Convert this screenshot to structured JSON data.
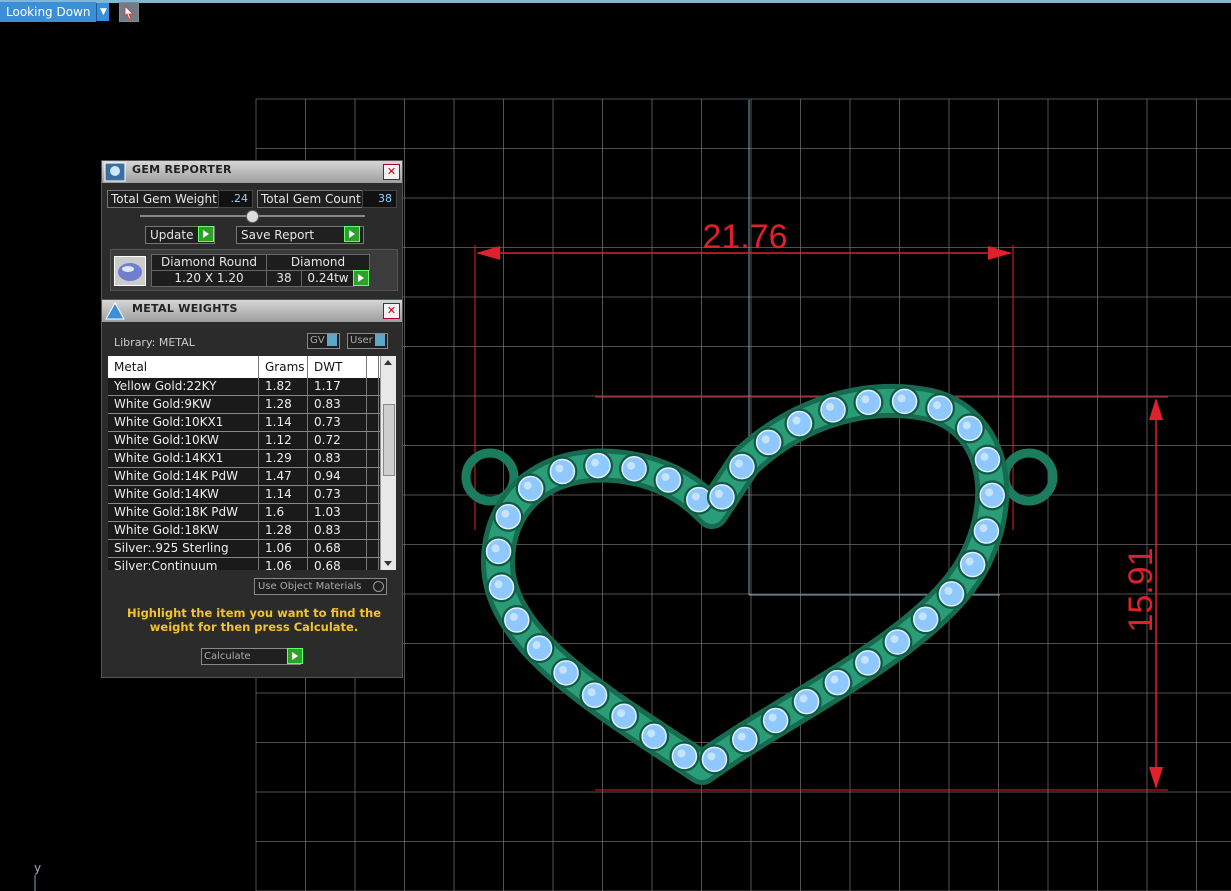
{
  "view": {
    "label": "Looking Down"
  },
  "viewport": {
    "axis_label": "y",
    "dim_width": "21.76",
    "dim_height": "15.91"
  },
  "gem_reporter": {
    "title": "GEM REPORTER",
    "total_weight_label": "Total Gem Weight",
    "total_weight_value": ".24",
    "total_count_label": "Total Gem Count",
    "total_count_value": "38",
    "update_label": "Update",
    "save_label": "Save Report",
    "gem": {
      "shape": "Diamond Round",
      "size": "1.20 X 1.20",
      "type": "Diamond",
      "count": "38",
      "weight": "0.24tw"
    }
  },
  "metal_weights": {
    "title": "METAL WEIGHTS",
    "library_label": "Library: METAL",
    "toggle_gv": "GV",
    "toggle_user": "User",
    "columns": [
      "Metal",
      "Grams",
      "DWT"
    ],
    "rows": [
      [
        "Yellow Gold:22KY",
        "1.82",
        "1.17"
      ],
      [
        "White Gold:9KW",
        "1.28",
        "0.83"
      ],
      [
        "White Gold:10KX1",
        "1.14",
        "0.73"
      ],
      [
        "White Gold:10KW",
        "1.12",
        "0.72"
      ],
      [
        "White Gold:14KX1",
        "1.29",
        "0.83"
      ],
      [
        "White Gold:14K PdW",
        "1.47",
        "0.94"
      ],
      [
        "White Gold:14KW",
        "1.14",
        "0.73"
      ],
      [
        "White Gold:18K PdW",
        "1.6",
        "1.03"
      ],
      [
        "White Gold:18KW",
        "1.28",
        "0.83"
      ],
      [
        "Silver:.925 Sterling",
        "1.06",
        "0.68"
      ],
      [
        "Silver:Continuum",
        "1.06",
        "0.68"
      ]
    ],
    "use_object_materials": "Use Object Materials",
    "hint": "Highlight the item you want to find the weight for then press Calculate.",
    "calculate_label": "Calculate"
  },
  "colors": {
    "grid": "#6a6a6a",
    "dimension": "#e0202a",
    "metal": "#1e8a6a",
    "gem": "#8ec8ff",
    "accent": "#3a8fd8"
  }
}
